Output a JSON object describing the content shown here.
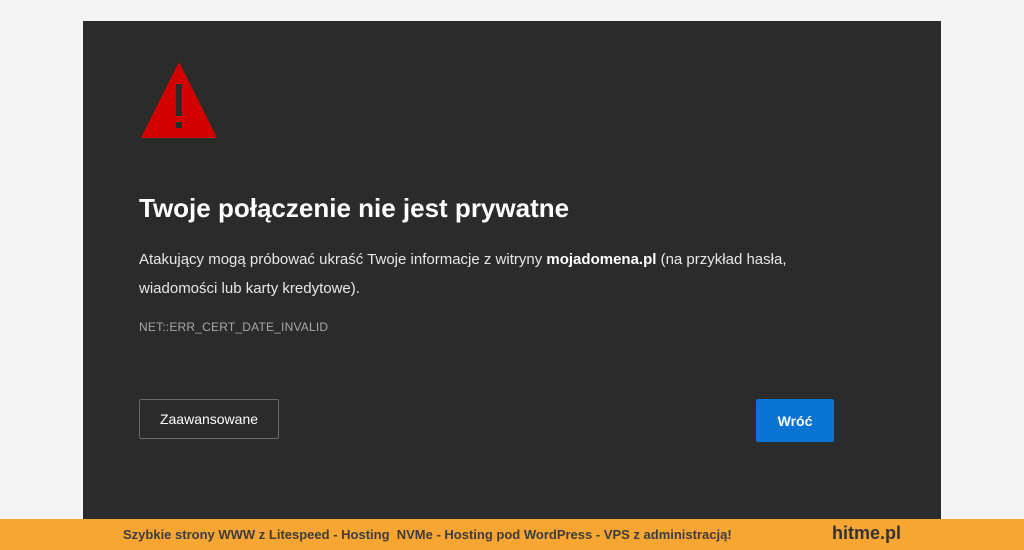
{
  "page": {
    "background": "#f4f4f4",
    "panel_color": "#2b2b2b",
    "warning_color": "#d40000"
  },
  "error": {
    "icon": "warning-triangle-icon",
    "title": "Twoje połączenie nie jest prywatne",
    "description_prefix": "Atakujący mogą próbować ukraść Twoje informacje z witryny ",
    "domain": "mojadomena.pl",
    "description_suffix": " (na przykład hasła, wiadomości lub karty kredytowe).",
    "code": "NET::ERR_CERT_DATE_INVALID"
  },
  "buttons": {
    "advanced_label": "Zaawansowane",
    "back_label": "Wróć",
    "back_color": "#0a74d4"
  },
  "footer": {
    "background": "#f7a533",
    "text": "Szybkie strony WWW z Litespeed - Hosting  NVMe - Hosting pod WordPress - VPS z administracją!",
    "brand": "hitme.pl"
  }
}
